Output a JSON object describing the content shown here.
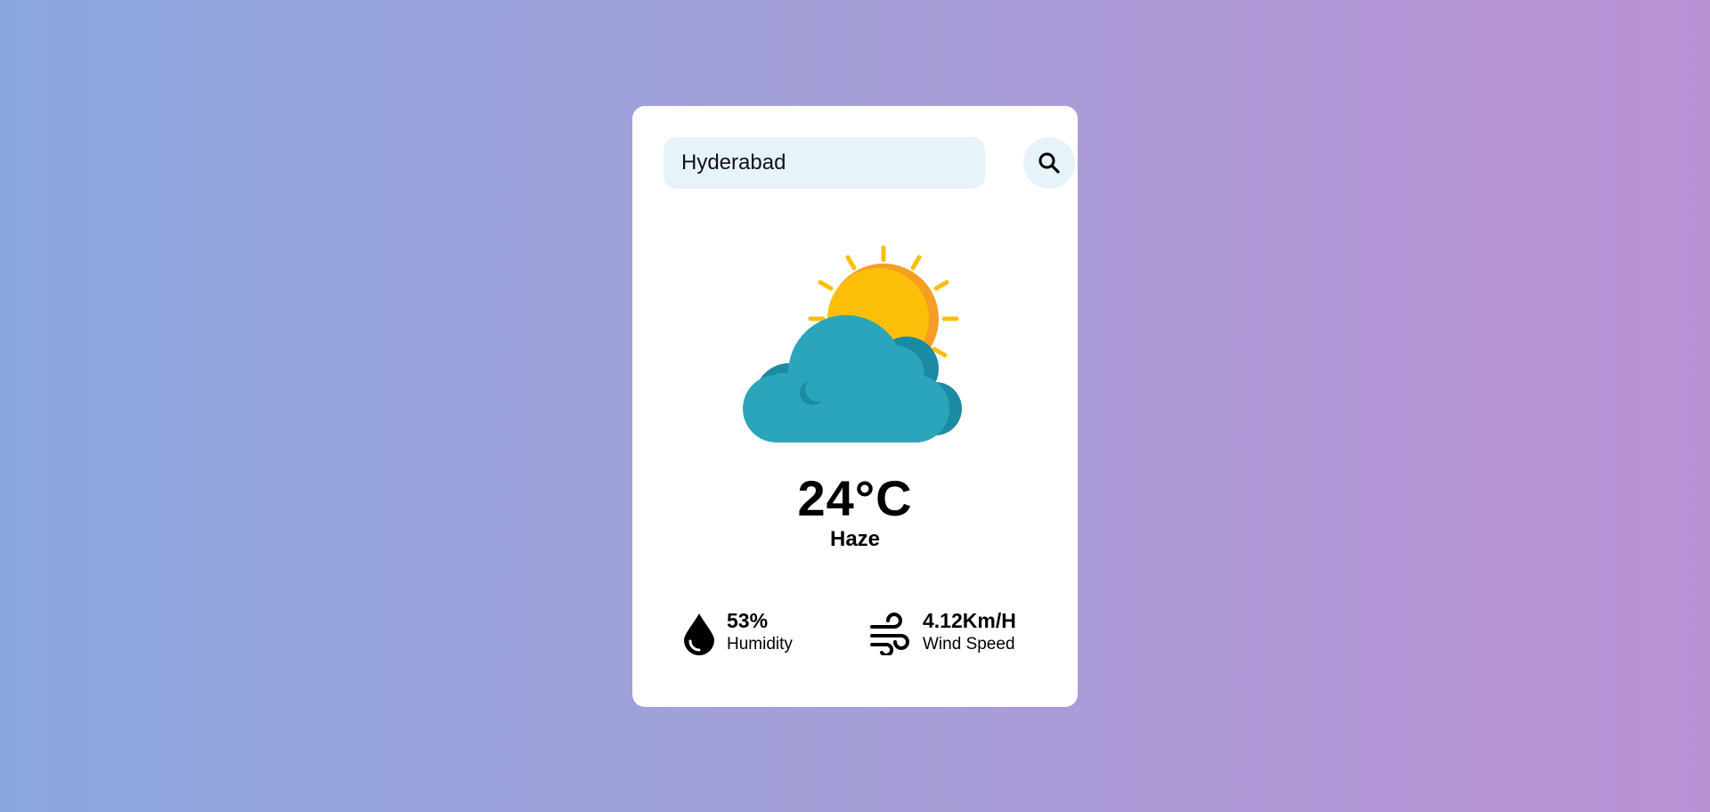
{
  "search": {
    "value": "Hyderabad",
    "button_icon": "search-icon"
  },
  "weather": {
    "icon": "partly-cloudy-icon",
    "temperature": "24°C",
    "condition": "Haze"
  },
  "humidity": {
    "icon": "water-drop-icon",
    "value": "53%",
    "label": "Humidity"
  },
  "wind": {
    "icon": "wind-icon",
    "value": "4.12Km/H",
    "label": "Wind Speed"
  },
  "colors": {
    "background_start": "#8ca7df",
    "background_end": "#bb91d6",
    "card": "#ffffff",
    "input_bg": "#e6f4fa",
    "sun": "#fbbf0a",
    "sun_shade": "#f59e22",
    "cloud": "#2aa5bb",
    "cloud_shade": "#1b8aa3"
  }
}
